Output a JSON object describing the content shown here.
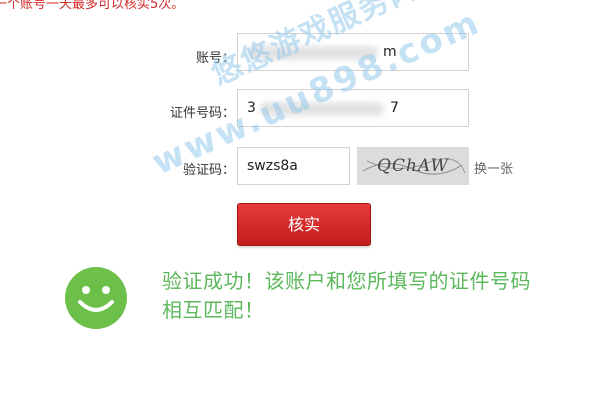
{
  "notice": "一个账号一天最多可以核实5次。",
  "form": {
    "account_label": "账号：",
    "account_value_start": "",
    "account_value_end": "m",
    "id_label": "证件号码：",
    "id_value_start": "3",
    "id_value_end": "7",
    "captcha_label": "验证码：",
    "captcha_value": "swzs8a",
    "captcha_image_text": "QChAW",
    "refresh_label": "换一张",
    "submit_label": "核实"
  },
  "result": {
    "message": "验证成功！该账户和您所填写的证件号码相互匹配！",
    "icon": "smiley-face-icon",
    "color": "#5cb85c"
  },
  "watermark": {
    "line1": "悠悠游戏服务网",
    "line2": "www.uu898.com"
  },
  "colors": {
    "notice": "#d42a2a",
    "button": "#d42a2a",
    "success": "#5cb85c",
    "watermark": "#96c8eb"
  }
}
